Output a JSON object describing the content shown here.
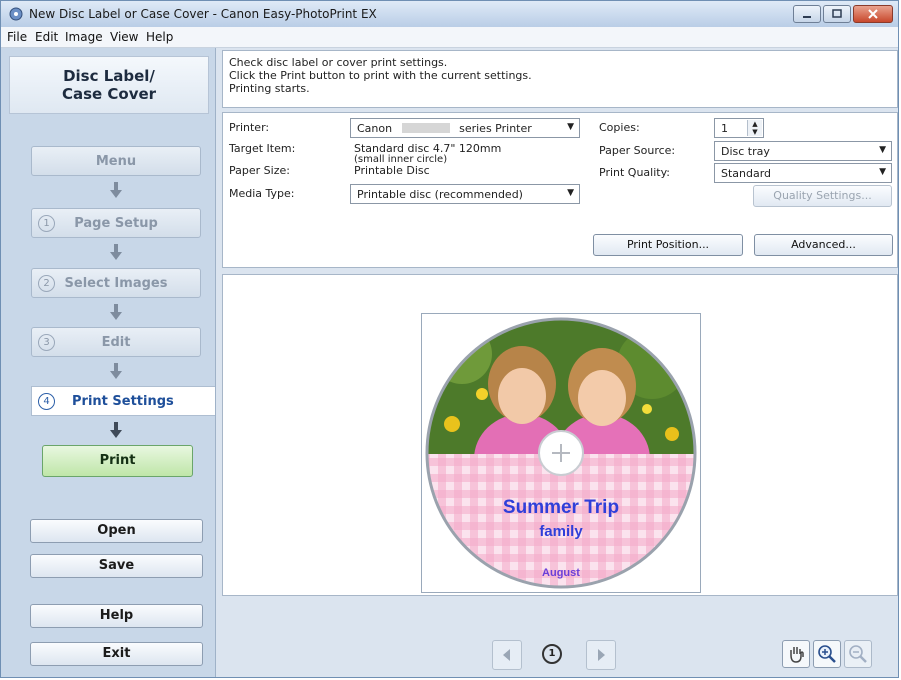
{
  "window": {
    "title": "New Disc Label or Case Cover - Canon Easy-PhotoPrint EX"
  },
  "menu": [
    "File",
    "Edit",
    "Image",
    "View",
    "Help"
  ],
  "sidebar": {
    "heading_line1": "Disc Label/",
    "heading_line2": "Case Cover",
    "menu_label": "Menu",
    "steps": [
      {
        "num": "1",
        "label": "Page Setup"
      },
      {
        "num": "2",
        "label": "Select Images"
      },
      {
        "num": "3",
        "label": "Edit"
      },
      {
        "num": "4",
        "label": "Print Settings"
      }
    ],
    "print_label": "Print",
    "open_label": "Open",
    "save_label": "Save",
    "help_label": "Help",
    "exit_label": "Exit"
  },
  "info": {
    "line1": "Check disc label or cover print settings.",
    "line2": "Click the Print button to print with the current settings.",
    "line3": "Printing starts."
  },
  "settings": {
    "printer_label": "Printer:",
    "printer_value": "Canon",
    "printer_suffix": "series Printer",
    "target_label": "Target Item:",
    "target_value1": "Standard disc 4.7\" 120mm",
    "target_value2": "(small inner circle)",
    "paper_size_label": "Paper Size:",
    "paper_size_value": "Printable Disc",
    "media_label": "Media Type:",
    "media_value": "Printable disc (recommended)",
    "copies_label": "Copies:",
    "copies_value": "1",
    "source_label": "Paper Source:",
    "source_value": "Disc tray",
    "quality_label": "Print Quality:",
    "quality_value": "Standard",
    "quality_settings_label": "Quality Settings...",
    "print_position_label": "Print Position...",
    "advanced_label": "Advanced..."
  },
  "preview": {
    "title": "Summer Trip",
    "subtitle": "family",
    "footer": "August",
    "page_number": "1"
  },
  "colors": {
    "title_text": "#2f3fd9",
    "footer_text": "#6b3fd9",
    "gingham": "#f4a9c8",
    "print_button": "#c9ebb2"
  }
}
